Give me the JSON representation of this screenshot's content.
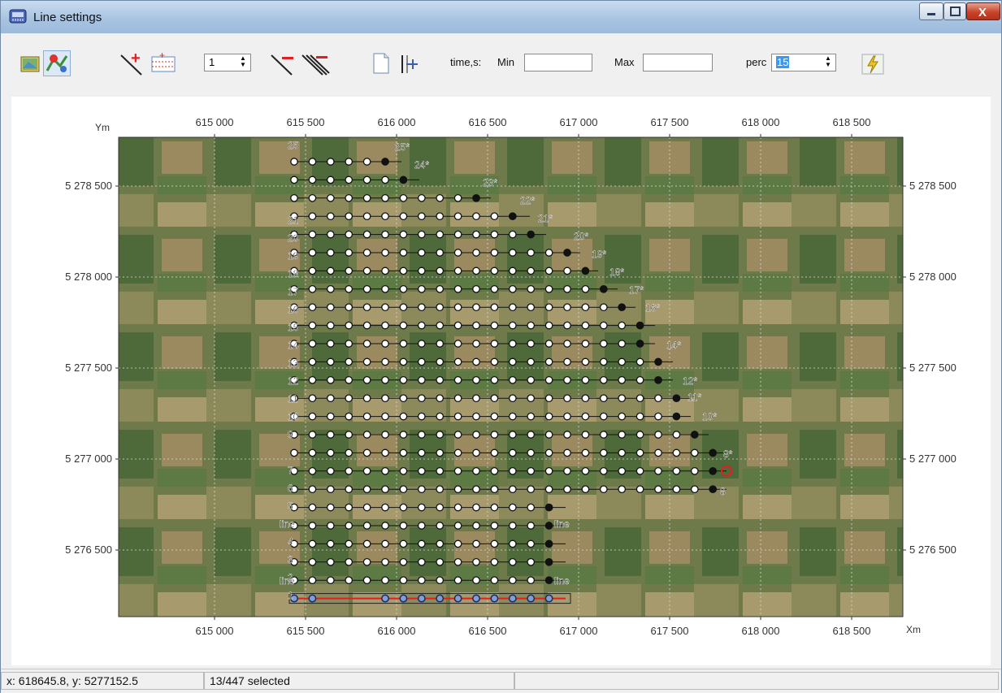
{
  "window": {
    "title": "Line settings"
  },
  "toolbar": {
    "line_count_value": "1",
    "time_label": "time,s:",
    "min_label": "Min",
    "min_value": "",
    "max_label": "Max",
    "max_value": "",
    "perc_label": "perc",
    "perc_value": "15"
  },
  "plot": {
    "y_axis_title": "Ym",
    "x_axis_title": "Xm",
    "x_ticks": [
      "615 000",
      "615 500",
      "616 000",
      "616 500",
      "617 000",
      "617 500",
      "618 000",
      "618 500"
    ],
    "y_ticks": [
      "5 278 500",
      "5 278 000",
      "5 277 500",
      "5 277 000",
      "5 276 500"
    ],
    "line_labels": [
      {
        "text": "25"
      },
      {
        "text": "25*"
      },
      {
        "text": "24*"
      },
      {
        "text": "23*"
      },
      {
        "text": "22*"
      },
      {
        "text": "21*"
      },
      {
        "text": "20*"
      },
      {
        "text": "19*"
      },
      {
        "text": "18*"
      },
      {
        "text": "17*"
      },
      {
        "text": "16*"
      },
      {
        "text": "14*"
      },
      {
        "text": "12*"
      },
      {
        "text": "11*"
      },
      {
        "text": "10*"
      },
      {
        "text": "8*"
      },
      {
        "text": "8"
      },
      {
        "text": "line"
      },
      {
        "text": "line"
      },
      {
        "text": "line"
      },
      {
        "text": "line"
      },
      {
        "text": "21"
      },
      {
        "text": "20"
      },
      {
        "text": "19"
      },
      {
        "text": "18"
      },
      {
        "text": "17"
      },
      {
        "text": "16"
      },
      {
        "text": "15"
      },
      {
        "text": "14"
      },
      {
        "text": "13"
      },
      {
        "text": "12"
      },
      {
        "text": "11"
      },
      {
        "text": "10"
      },
      {
        "text": "9"
      },
      {
        "text": "7"
      },
      {
        "text": "6"
      },
      {
        "text": "5"
      },
      {
        "text": "4"
      },
      {
        "text": "3"
      },
      {
        "text": "2"
      },
      {
        "text": "1"
      }
    ]
  },
  "statusbar": {
    "coords": "x: 618645.8, y: 5277152.5",
    "selection": "13/447 selected"
  },
  "colors": {
    "selected_line": "#e02020",
    "title_bar": "#a9c4e2"
  }
}
